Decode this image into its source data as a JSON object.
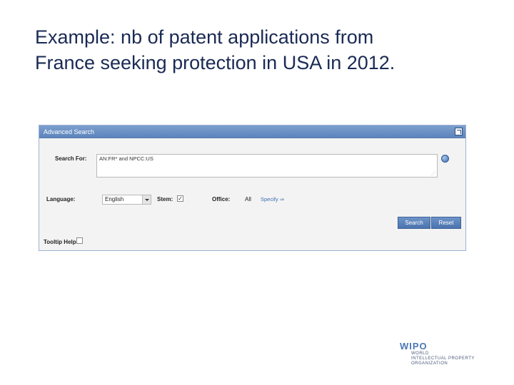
{
  "slide": {
    "title_line1": "Example: nb of patent applications from",
    "title_line2": "France seeking protection in USA in 2012."
  },
  "panel": {
    "header_title": "Advanced Search",
    "search_label": "Search For:",
    "search_value": "AN:FR* and NPCC:US",
    "language_label": "Language:",
    "language_selected": "English",
    "stem_label": "Stem:",
    "stem_checked": true,
    "stem_check_glyph": "✓",
    "office_label": "Office:",
    "office_value": "All",
    "specify_link": "Specify ⇒",
    "search_button": "Search",
    "reset_button": "Reset",
    "tooltip_label": "Tooltip Help",
    "tooltip_checked": false
  },
  "logo": {
    "main": "WIPO",
    "sub1": "WORLD",
    "sub2": "INTELLECTUAL PROPERTY",
    "sub3": "ORGANIZATION"
  },
  "icons": {
    "expand": "expand-icon",
    "help": "help-icon",
    "dropdown": "chevron-down-icon"
  },
  "colors": {
    "header": "#5a82bb",
    "button": "#4a73ae",
    "title_text": "#1a2a55",
    "logo": "#4a78b5"
  }
}
